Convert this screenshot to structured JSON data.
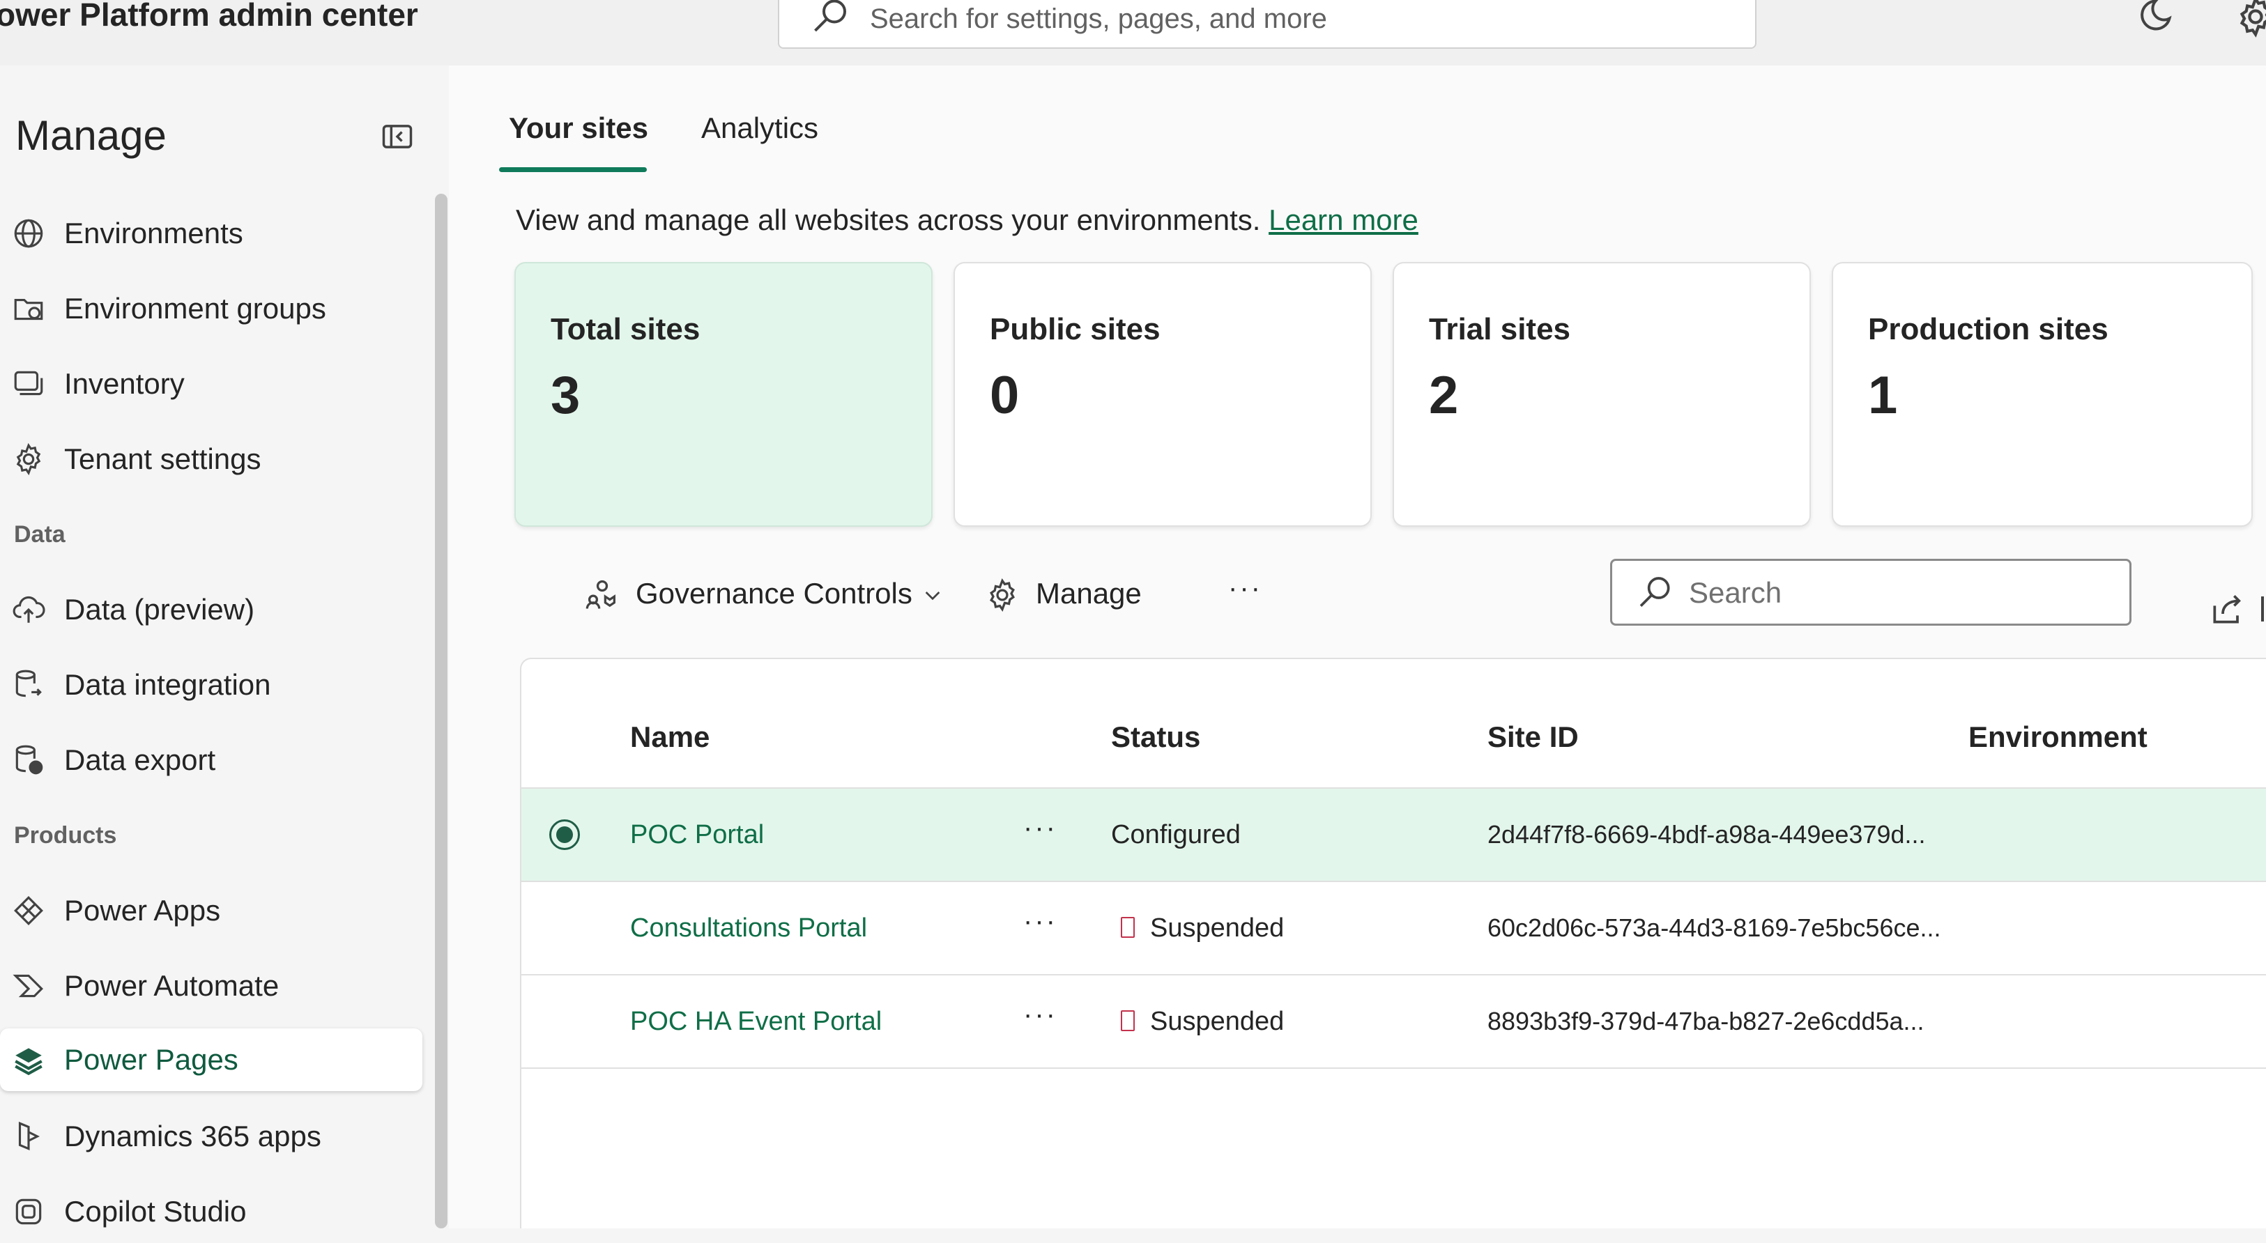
{
  "header": {
    "app_title": "ower Platform admin center",
    "search_placeholder": "Search for settings, pages, and more"
  },
  "sidebar": {
    "heading": "Manage",
    "sections": [
      {
        "label": ""
      },
      {
        "label": "Data"
      },
      {
        "label": "Products"
      }
    ],
    "items": [
      {
        "label": "Environments",
        "icon": "globe-icon"
      },
      {
        "label": "Environment groups",
        "icon": "folder-globe-icon"
      },
      {
        "label": "Inventory",
        "icon": "inventory-icon"
      },
      {
        "label": "Tenant settings",
        "icon": "gear-icon"
      },
      {
        "label": "Data (preview)",
        "icon": "cloud-upload-icon"
      },
      {
        "label": "Data integration",
        "icon": "database-link-icon"
      },
      {
        "label": "Data export",
        "icon": "database-export-icon"
      },
      {
        "label": "Power Apps",
        "icon": "power-apps-icon"
      },
      {
        "label": "Power Automate",
        "icon": "power-automate-icon"
      },
      {
        "label": "Power Pages",
        "icon": "power-pages-icon",
        "active": true
      },
      {
        "label": "Dynamics 365 apps",
        "icon": "dynamics-icon"
      },
      {
        "label": "Copilot Studio",
        "icon": "copilot-studio-icon"
      }
    ]
  },
  "tabs": [
    {
      "label": "Your sites",
      "selected": true
    },
    {
      "label": "Analytics",
      "selected": false
    }
  ],
  "intro": {
    "text": "View and manage all websites across your environments. ",
    "link": "Learn more"
  },
  "cards": [
    {
      "title": "Total sites",
      "value": "3"
    },
    {
      "title": "Public sites",
      "value": "0"
    },
    {
      "title": "Trial sites",
      "value": "2"
    },
    {
      "title": "Production sites",
      "value": "1"
    }
  ],
  "toolbar": {
    "governance": "Governance Controls",
    "manage": "Manage",
    "more": "···",
    "search_placeholder": "Search"
  },
  "table": {
    "columns": [
      "Name",
      "Status",
      "Site ID",
      "Environment"
    ],
    "rows": [
      {
        "name": "POC Portal",
        "actions": "···",
        "status": "Configured",
        "site_id": "2d44f7f8-6669-4bdf-a98a-449ee379d...",
        "environment": "",
        "selected": true
      },
      {
        "name": "Consultations Portal",
        "actions": "···",
        "status": "Suspended",
        "site_id": "60c2d06c-573a-44d3-8169-7e5bc56ce...",
        "environment": "",
        "selected": false
      },
      {
        "name": "POC HA Event Portal",
        "actions": "···",
        "status": "Suspended",
        "site_id": "8893b3f9-379d-47ba-b827-2e6cdd5a...",
        "environment": "",
        "selected": false
      }
    ]
  },
  "colors": {
    "accent": "#0f7b5a",
    "link": "#0f6e47",
    "selected_bg": "#e3f6ec",
    "suspended": "#c4314b"
  }
}
